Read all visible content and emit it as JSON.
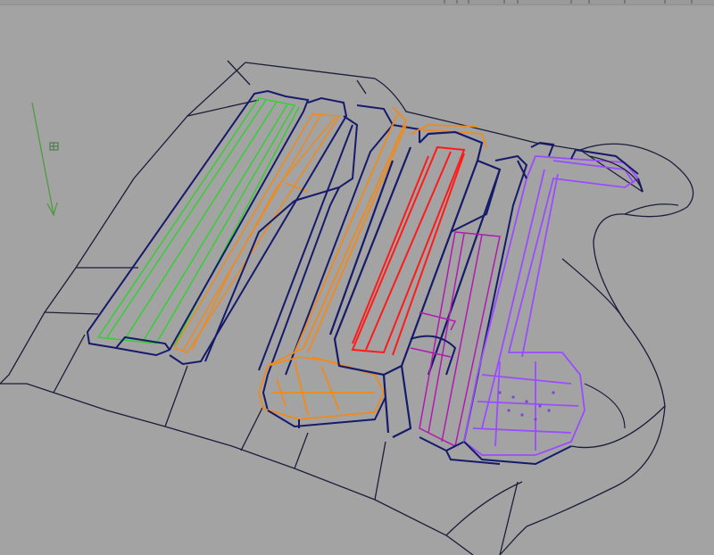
{
  "viewport": {
    "background_color": "#a3a3a3",
    "wire_color": "#1c1c3a"
  },
  "widgets": {
    "axis_arrow_icon": "axis-arrow-icon",
    "pivot_icon": "pivot-marker-icon"
  },
  "part_colors": {
    "green": "#2fd12f",
    "orange": "#f08a1c",
    "red": "#ff1a1a",
    "magenta": "#b01ab0",
    "purple": "#9a4cff",
    "navy": "#161a6a",
    "axis_arrow": "#4a9a3a"
  }
}
